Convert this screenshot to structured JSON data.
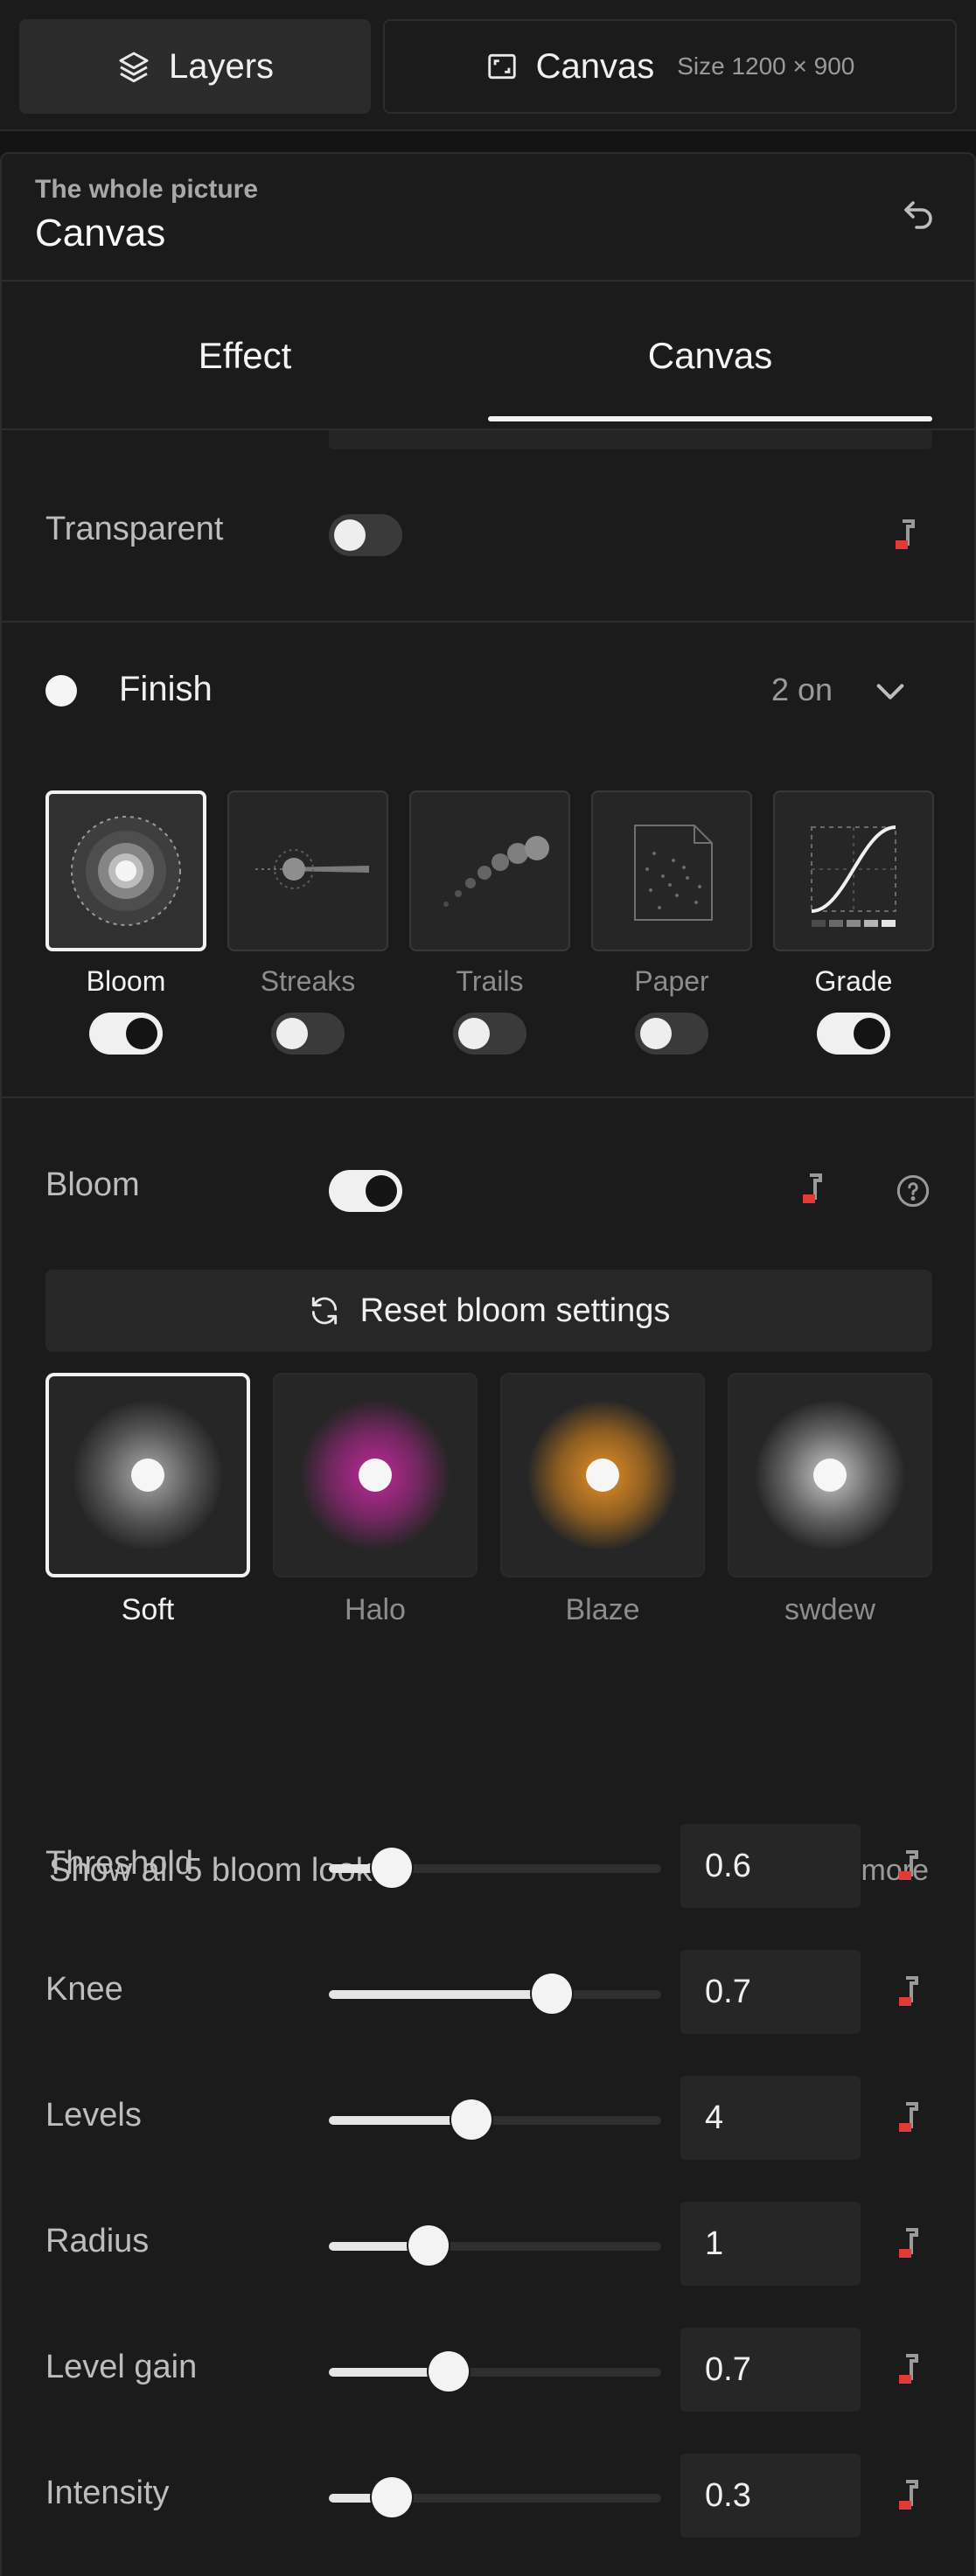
{
  "top_tabs": {
    "layers_label": "Layers",
    "canvas_label": "Canvas",
    "canvas_size": "Size 1200 × 900"
  },
  "panel": {
    "subtitle": "The whole picture",
    "title": "Canvas",
    "tabs": [
      {
        "label": "Effect",
        "active": false
      },
      {
        "label": "Canvas",
        "active": true
      }
    ]
  },
  "transparent": {
    "label": "Transparent",
    "on": false
  },
  "finish": {
    "label": "Finish",
    "count": "2 on",
    "effects": [
      {
        "label": "Bloom",
        "on": true,
        "selected": true
      },
      {
        "label": "Streaks",
        "on": false,
        "selected": false
      },
      {
        "label": "Trails",
        "on": false,
        "selected": false
      },
      {
        "label": "Paper",
        "on": false,
        "selected": false
      },
      {
        "label": "Grade",
        "on": true,
        "selected": false
      }
    ]
  },
  "bloom": {
    "label": "Bloom",
    "on": true,
    "reset_label": "Reset bloom settings",
    "looks": [
      {
        "label": "Soft",
        "selected": true,
        "color": "#d8d8d8"
      },
      {
        "label": "Halo",
        "selected": false,
        "color": "#b0288f"
      },
      {
        "label": "Blaze",
        "selected": false,
        "color": "#e08a1e"
      },
      {
        "label": "swdew",
        "selected": false,
        "color": "#d8d8d8"
      }
    ],
    "show_all_label": "Show all 5 bloom looks",
    "more_label": "1 more",
    "sliders": [
      {
        "label": "Threshold",
        "value": "0.6",
        "fraction": 0.19
      },
      {
        "label": "Knee",
        "value": "0.7",
        "fraction": 0.67
      },
      {
        "label": "Levels",
        "value": "4",
        "fraction": 0.43
      },
      {
        "label": "Radius",
        "value": "1",
        "fraction": 0.3
      },
      {
        "label": "Level gain",
        "value": "0.7",
        "fraction": 0.36
      },
      {
        "label": "Intensity",
        "value": "0.3",
        "fraction": 0.19
      }
    ]
  },
  "colors": {
    "accent_key": "#e53935",
    "bg": "#1b1b1b"
  },
  "icons": [
    "layers-icon",
    "canvas-frame-icon",
    "undo-icon",
    "keyframe-icon",
    "chevron-down-icon",
    "refresh-icon",
    "help-icon"
  ]
}
